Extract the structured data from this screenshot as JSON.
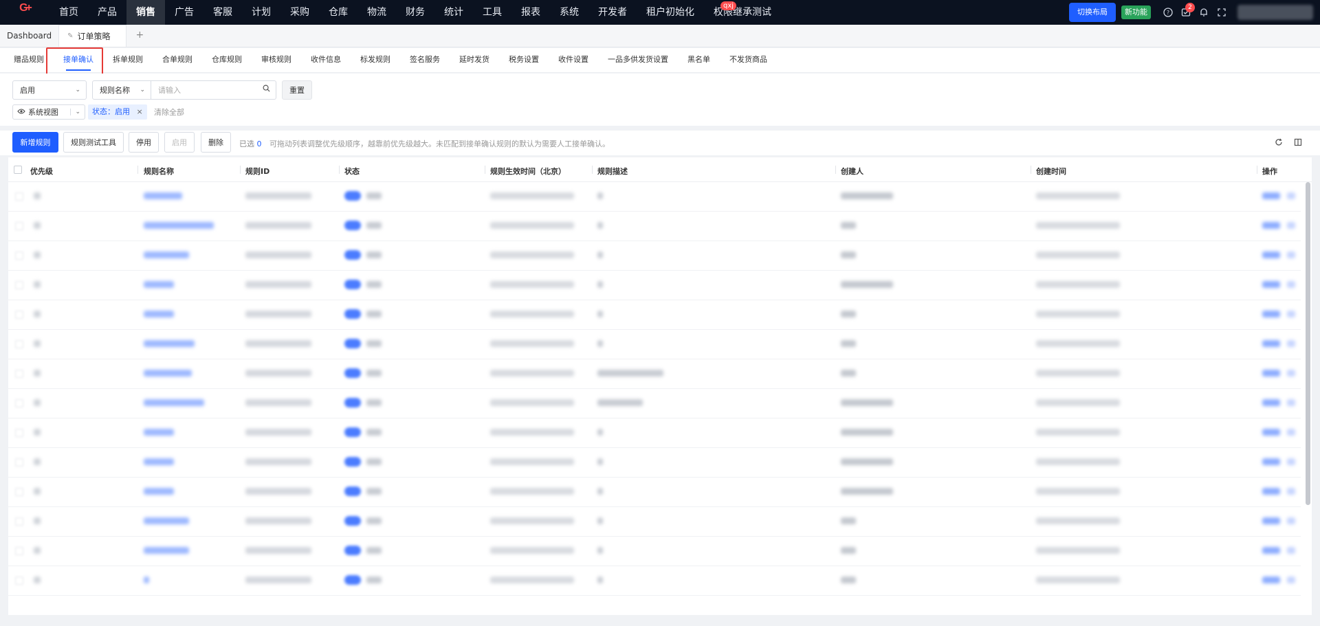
{
  "brand": {
    "logo_text": "G",
    "logo_plus": "+"
  },
  "topnav": {
    "items": [
      "首页",
      "产品",
      "销售",
      "广告",
      "客服",
      "计划",
      "采购",
      "仓库",
      "物流",
      "财务",
      "统计",
      "工具",
      "报表",
      "系统",
      "开发者",
      "租户初始化",
      "权限继承测试"
    ],
    "active_index": 2,
    "badge_item_index": 16,
    "badge_text": "qxj",
    "switch_layout": "切换布局",
    "new_feature": "新功能",
    "task_badge": "2"
  },
  "tabs": {
    "dashboard": "Dashboard",
    "active": "订单策略",
    "add": "+"
  },
  "subnav": {
    "items": [
      "赠品规则",
      "接单确认",
      "拆单规则",
      "合单规则",
      "仓库规则",
      "审核规则",
      "收件信息",
      "标发规则",
      "签名服务",
      "延时发货",
      "税务设置",
      "收件设置",
      "一品多供发货设置",
      "黑名单",
      "不发货商品"
    ],
    "active_index": 1
  },
  "filters": {
    "status_select": "启用",
    "field_select": "规则名称",
    "search_placeholder": "请输入",
    "reset": "重置",
    "view_select": "系统视图",
    "chip": "状态：启用",
    "chip_close": "×",
    "clear_all": "清除全部"
  },
  "toolbar": {
    "add": "新增规则",
    "test_tool": "规则测试工具",
    "disable": "停用",
    "enable": "启用",
    "delete": "删除",
    "selected_prefix": "已选",
    "selected_count": "0",
    "tip": "可拖动列表调整优先级顺序，越靠前优先级越大。未匹配到接单确认规则的默认为需要人工接单确认。"
  },
  "table": {
    "headers": {
      "priority": "优先级",
      "name": "规则名称",
      "id": "规则ID",
      "status": "状态",
      "effective": "规则生效时间（北京）",
      "desc": "规则描述",
      "creator": "创建人",
      "created": "创建时间",
      "ops": "操作"
    },
    "rows": [
      {
        "name_w": 56,
        "desc_w": 8,
        "creator_w": 76
      },
      {
        "name_w": 102,
        "desc_w": 8,
        "creator_w": 22
      },
      {
        "name_w": 66,
        "desc_w": 8,
        "creator_w": 22
      },
      {
        "name_w": 44,
        "desc_w": 8,
        "creator_w": 76
      },
      {
        "name_w": 44,
        "desc_w": 8,
        "creator_w": 22
      },
      {
        "name_w": 74,
        "desc_w": 8,
        "creator_w": 22
      },
      {
        "name_w": 70,
        "desc_w": 96,
        "creator_w": 22
      },
      {
        "name_w": 88,
        "desc_w": 66,
        "creator_w": 76
      },
      {
        "name_w": 44,
        "desc_w": 8,
        "creator_w": 76
      },
      {
        "name_w": 44,
        "desc_w": 8,
        "creator_w": 76
      },
      {
        "name_w": 44,
        "desc_w": 8,
        "creator_w": 76
      },
      {
        "name_w": 66,
        "desc_w": 8,
        "creator_w": 22
      },
      {
        "name_w": 66,
        "desc_w": 8,
        "creator_w": 22
      },
      {
        "name_w": 8,
        "desc_w": 8,
        "creator_w": 22
      }
    ]
  }
}
